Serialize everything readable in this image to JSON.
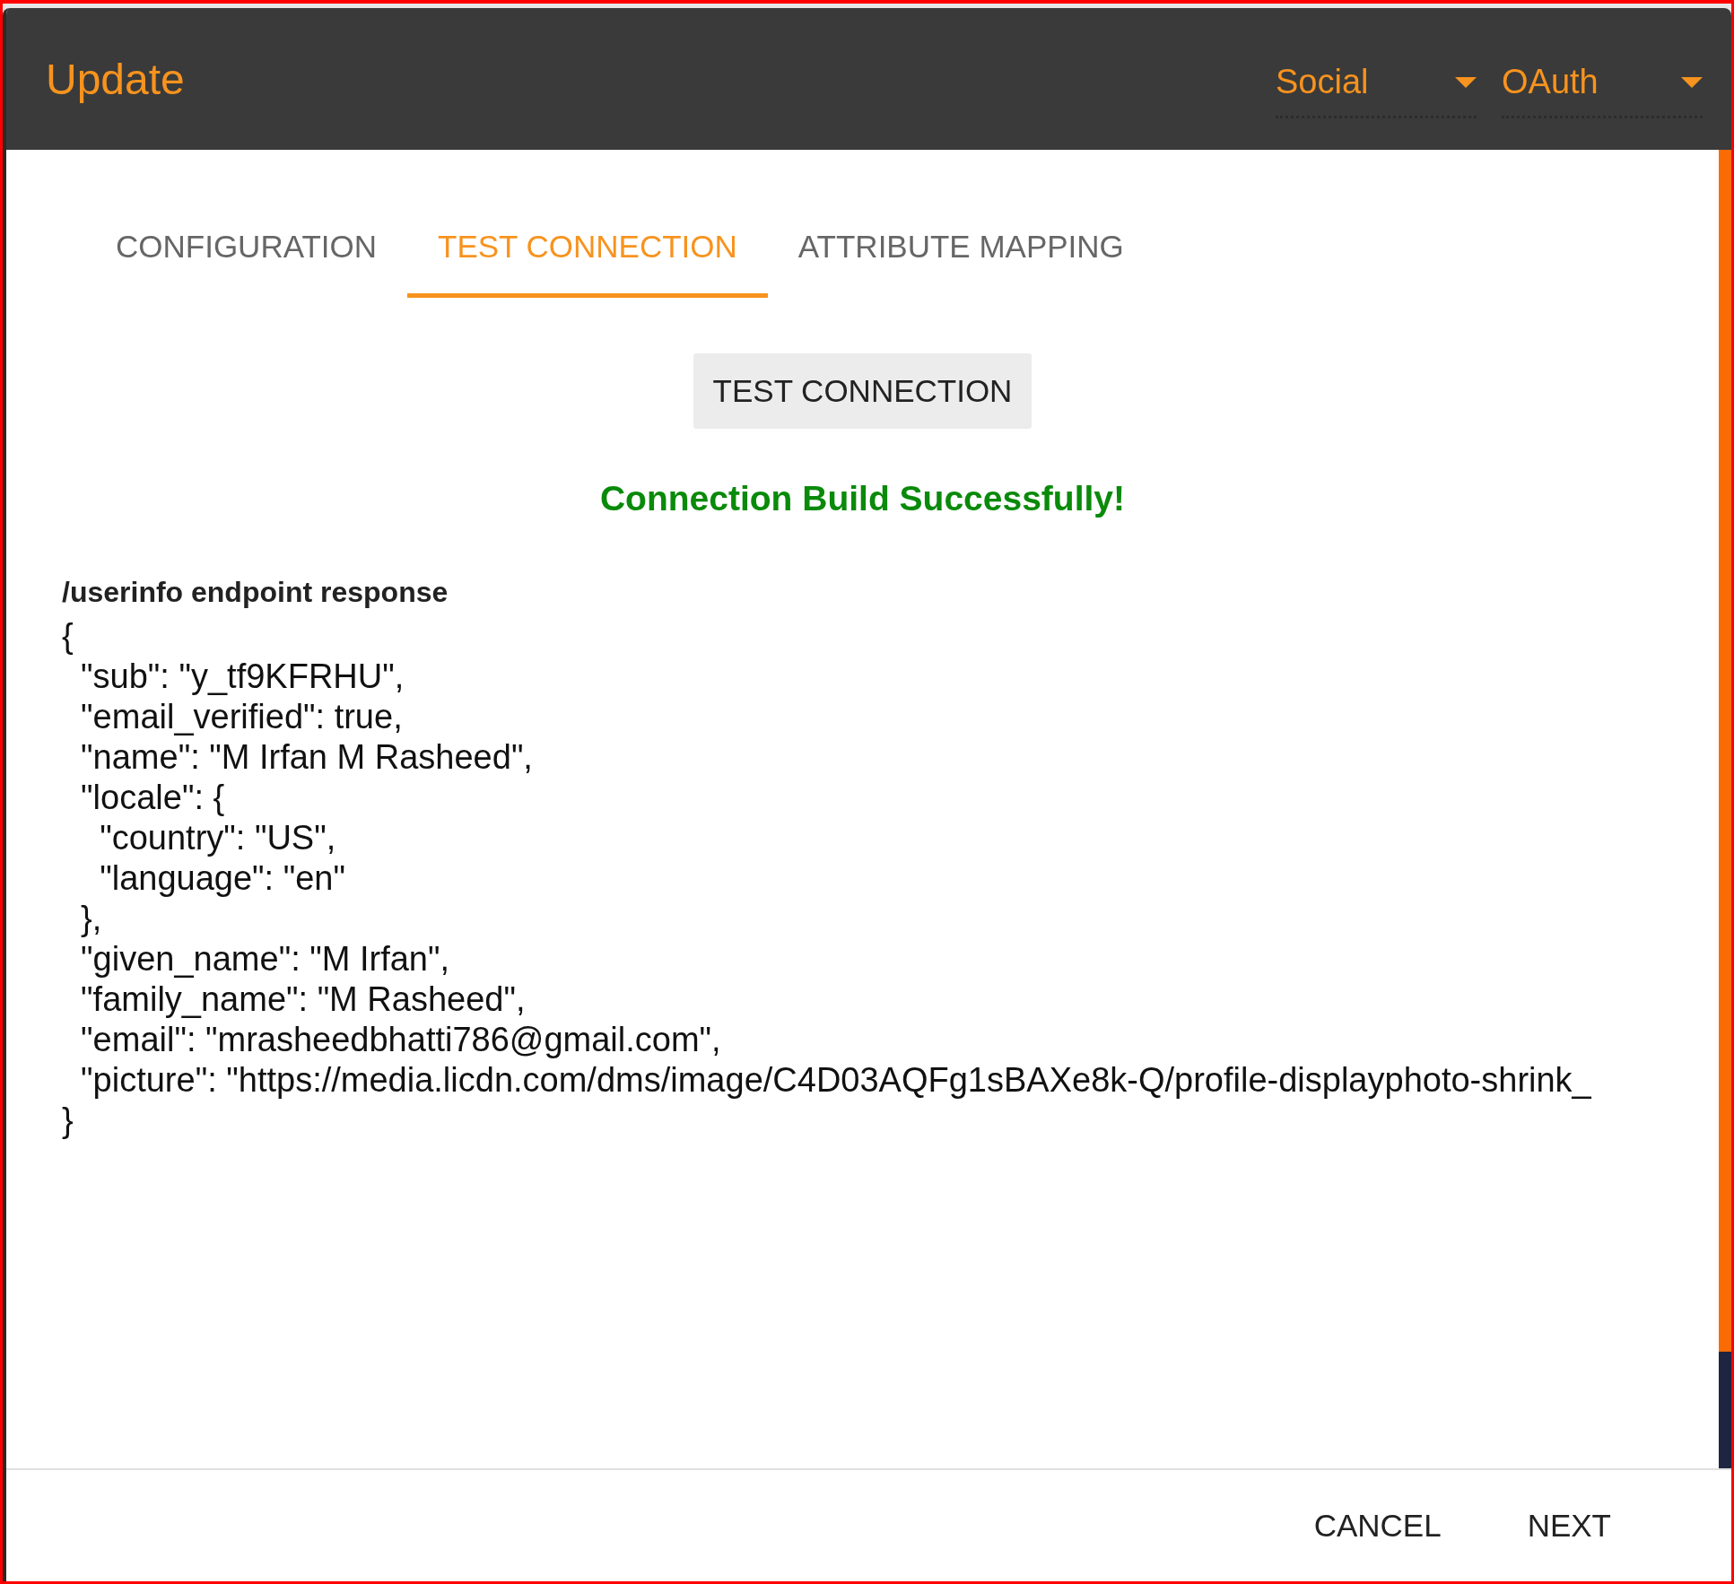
{
  "header": {
    "title": "Update",
    "dropdowns": [
      {
        "value": "Social"
      },
      {
        "value": "OAuth"
      }
    ]
  },
  "tabs": [
    {
      "label": "CONFIGURATION",
      "selected": false
    },
    {
      "label": "TEST CONNECTION",
      "selected": true
    },
    {
      "label": "ATTRIBUTE MAPPING",
      "selected": false
    }
  ],
  "test_button": "TEST CONNECTION",
  "status_message": "Connection Build Successfully!",
  "response": {
    "heading": "/userinfo endpoint response",
    "lines": [
      "{",
      "  \"sub\": \"y_tf9KFRHU\",",
      "  \"email_verified\": true,",
      "  \"name\": \"M Irfan M Rasheed\",",
      "  \"locale\": {",
      "    \"country\": \"US\",",
      "    \"language\": \"en\"",
      "  },",
      "  \"given_name\": \"M Irfan\",",
      "  \"family_name\": \"M Rasheed\",",
      "  \"email\": \"mrasheedbhatti786@gmail.com\",",
      "  \"picture\": \"https://media.licdn.com/dms/image/C4D03AQFg1sBAXe8k-Q/profile-displayphoto-shrink_",
      "}"
    ]
  },
  "footer_buttons": [
    "CANCEL",
    "NEXT"
  ]
}
